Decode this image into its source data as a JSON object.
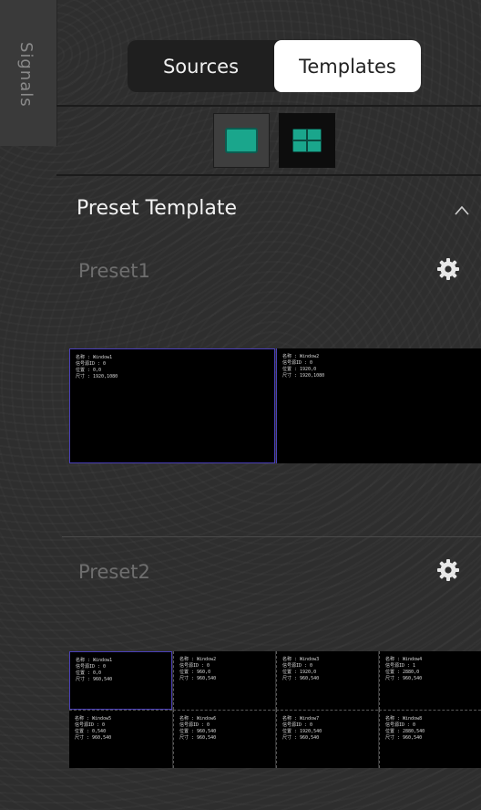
{
  "side_tab": {
    "label": "Signals"
  },
  "tabs": [
    {
      "label": "Sources",
      "active": false
    },
    {
      "label": "Templates",
      "active": true
    }
  ],
  "layout_buttons": [
    {
      "name": "single-layout-icon",
      "selected": false
    },
    {
      "name": "quad-layout-icon",
      "selected": true
    }
  ],
  "section": {
    "title": "Preset Template",
    "collapse_icon": "chevron-up-icon"
  },
  "presets": [
    {
      "title": "Preset1",
      "settings_icon": "gear-icon",
      "windows": [
        {
          "name": "名称 : Window1",
          "id": "信号源ID : 0",
          "pos": "位置 : 0,0",
          "size": "尺寸 : 1920,1080"
        },
        {
          "name": "名称 : Window2",
          "id": "信号源ID : 0",
          "pos": "位置 : 1920,0",
          "size": "尺寸 : 1920,1080"
        }
      ]
    },
    {
      "title": "Preset2",
      "settings_icon": "gear-icon",
      "windows": [
        {
          "name": "名称 : Window1",
          "id": "信号源ID : 0",
          "pos": "位置 : 0,0",
          "size": "尺寸 : 960,540"
        },
        {
          "name": "名称 : Window2",
          "id": "信号源ID : 0",
          "pos": "位置 : 960,0",
          "size": "尺寸 : 960,540"
        },
        {
          "name": "名称 : Window3",
          "id": "信号源ID : 0",
          "pos": "位置 : 1920,0",
          "size": "尺寸 : 960,540"
        },
        {
          "name": "名称 : Window4",
          "id": "信号源ID : 1",
          "pos": "位置 : 2880,0",
          "size": "尺寸 : 960,540"
        },
        {
          "name": "名称 : Window5",
          "id": "信号源ID : 0",
          "pos": "位置 : 0,540",
          "size": "尺寸 : 960,540"
        },
        {
          "name": "名称 : Window6",
          "id": "信号源ID : 0",
          "pos": "位置 : 960,540",
          "size": "尺寸 : 960,540"
        },
        {
          "name": "名称 : Window7",
          "id": "信号源ID : 0",
          "pos": "位置 : 1920,540",
          "size": "尺寸 : 960,540"
        },
        {
          "name": "名称 : Window8",
          "id": "信号源ID : 0",
          "pos": "位置 : 2880,540",
          "size": "尺寸 : 960,540"
        }
      ]
    }
  ],
  "colors": {
    "accent": "#1aa68c",
    "selection": "#4a3fb8",
    "background": "#2e2e2e"
  }
}
